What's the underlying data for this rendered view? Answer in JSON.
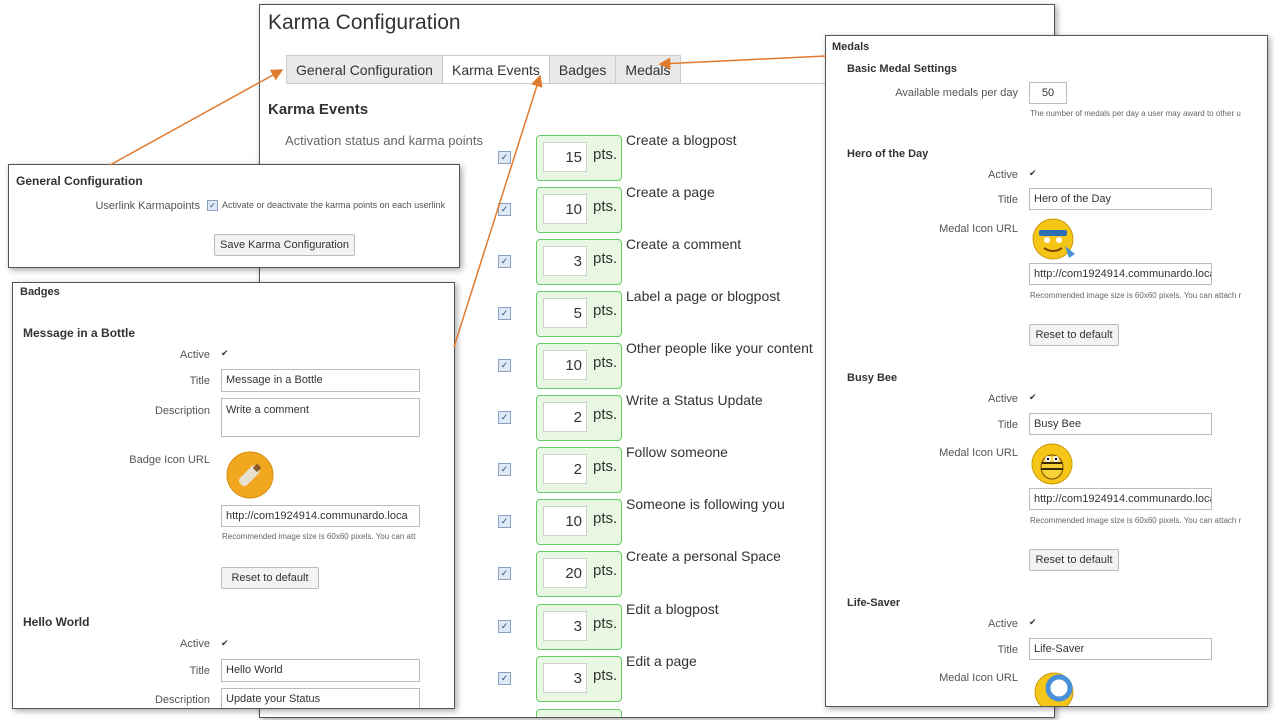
{
  "main": {
    "title": "Karma Configuration",
    "tabs": [
      {
        "label": "General Configuration",
        "active": false
      },
      {
        "label": "Karma Events",
        "active": true
      },
      {
        "label": "Badges",
        "active": false
      },
      {
        "label": "Medals",
        "active": false
      }
    ],
    "section_title": "Karma Events",
    "activation_label": "Activation status and karma points",
    "unit": "pts.",
    "events": [
      {
        "points": "15",
        "label": "Create a blogpost",
        "active": true
      },
      {
        "points": "10",
        "label": "Create a page",
        "active": true
      },
      {
        "points": "3",
        "label": "Create a comment",
        "active": true
      },
      {
        "points": "5",
        "label": "Label a page or blogpost",
        "active": true
      },
      {
        "points": "10",
        "label": "Other people like your content",
        "active": true
      },
      {
        "points": "2",
        "label": "Write a Status Update",
        "active": true
      },
      {
        "points": "2",
        "label": "Follow someone",
        "active": true
      },
      {
        "points": "10",
        "label": "Someone is following you",
        "active": true
      },
      {
        "points": "20",
        "label": "Create a personal Space",
        "active": true
      },
      {
        "points": "3",
        "label": "Edit a blogpost",
        "active": true
      },
      {
        "points": "3",
        "label": "Edit a page",
        "active": true
      }
    ]
  },
  "general": {
    "heading": "General Configuration",
    "userlink_label": "Userlink Karmapoints",
    "userlink_text": "Activate or deactivate the karma points on each userlink",
    "save_button": "Save Karma Configuration"
  },
  "badges": {
    "heading": "Badges",
    "labels": {
      "active": "Active",
      "title": "Title",
      "description": "Description",
      "icon_url": "Badge Icon URL"
    },
    "items": [
      {
        "name": "Message in a Bottle",
        "title_value": "Message in a Bottle",
        "description_value": "Write a comment",
        "icon_url_value": "http://com1924914.communardo.loca",
        "note": "Recommended image size is 60x60 pixels. You can att",
        "reset_button": "Reset to default"
      },
      {
        "name": "Hello World",
        "title_value": "Hello World",
        "description_value": "Update your Status"
      }
    ]
  },
  "medals": {
    "heading": "Medals",
    "basic_heading": "Basic Medal Settings",
    "per_day_label": "Available medals per day",
    "per_day_value": "50",
    "per_day_note": "The number of medals per day a user may award to other u",
    "labels": {
      "active": "Active",
      "title": "Title",
      "icon_url": "Medal Icon URL"
    },
    "items": [
      {
        "name": "Hero of the Day",
        "title_value": "Hero of the Day",
        "icon_url_value": "http://com1924914.communardo.loca",
        "note": "Recommended image size is 60x60 pixels. You can attach r",
        "reset_button": "Reset to default"
      },
      {
        "name": "Busy Bee",
        "title_value": "Busy Bee",
        "icon_url_value": "http://com1924914.communardo.loca",
        "note": "Recommended image size is 60x60 pixels. You can attach r",
        "reset_button": "Reset to default"
      },
      {
        "name": "Life-Saver",
        "title_value": "Life-Saver"
      }
    ]
  },
  "colors": {
    "arrow": "#e07a2e",
    "points_border": "#66cc66",
    "points_bg": "#e9f8e3"
  }
}
